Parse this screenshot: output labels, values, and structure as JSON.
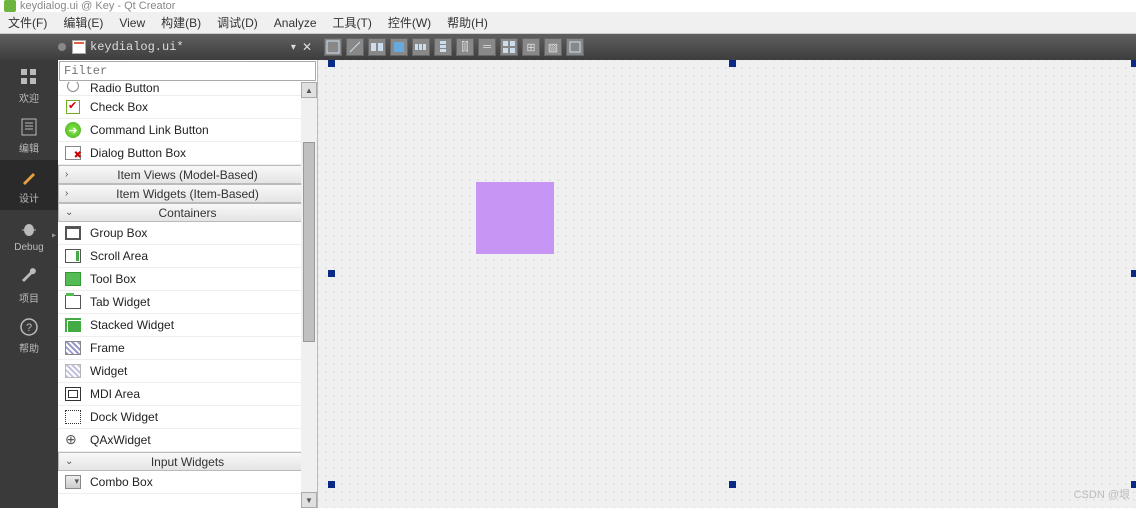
{
  "window_title": "keydialog.ui @ Key - Qt Creator",
  "menubar": [
    "文件(F)",
    "编辑(E)",
    "View",
    "构建(B)",
    "调试(D)",
    "Analyze",
    "工具(T)",
    "控件(W)",
    "帮助(H)"
  ],
  "document": {
    "name": "keydialog.ui*"
  },
  "filter": {
    "placeholder": "Filter"
  },
  "leftbar": [
    {
      "label": "欢迎",
      "icon": "grid"
    },
    {
      "label": "编辑",
      "icon": "doc"
    },
    {
      "label": "设计",
      "icon": "pencil",
      "active": true
    },
    {
      "label": "Debug",
      "icon": "bug",
      "arrow": true
    },
    {
      "label": "项目",
      "icon": "wrench"
    },
    {
      "label": "帮助",
      "icon": "help"
    }
  ],
  "widget_groups": {
    "cut_top": "Radio Button",
    "buttons": [
      "Check Box",
      "Command Link Button",
      "Dialog Button Box"
    ],
    "itemviews": "Item Views (Model-Based)",
    "itemwidgets": "Item Widgets (Item-Based)",
    "containers_header": "Containers",
    "containers": [
      "Group Box",
      "Scroll Area",
      "Tool Box",
      "Tab Widget",
      "Stacked Widget",
      "Frame",
      "Widget",
      "MDI Area",
      "Dock Widget",
      "QAxWidget"
    ],
    "input_header": "Input Widgets",
    "input": [
      "Combo Box"
    ]
  },
  "canvas": {
    "purple_widget": true
  },
  "watermark": "CSDN @垠"
}
